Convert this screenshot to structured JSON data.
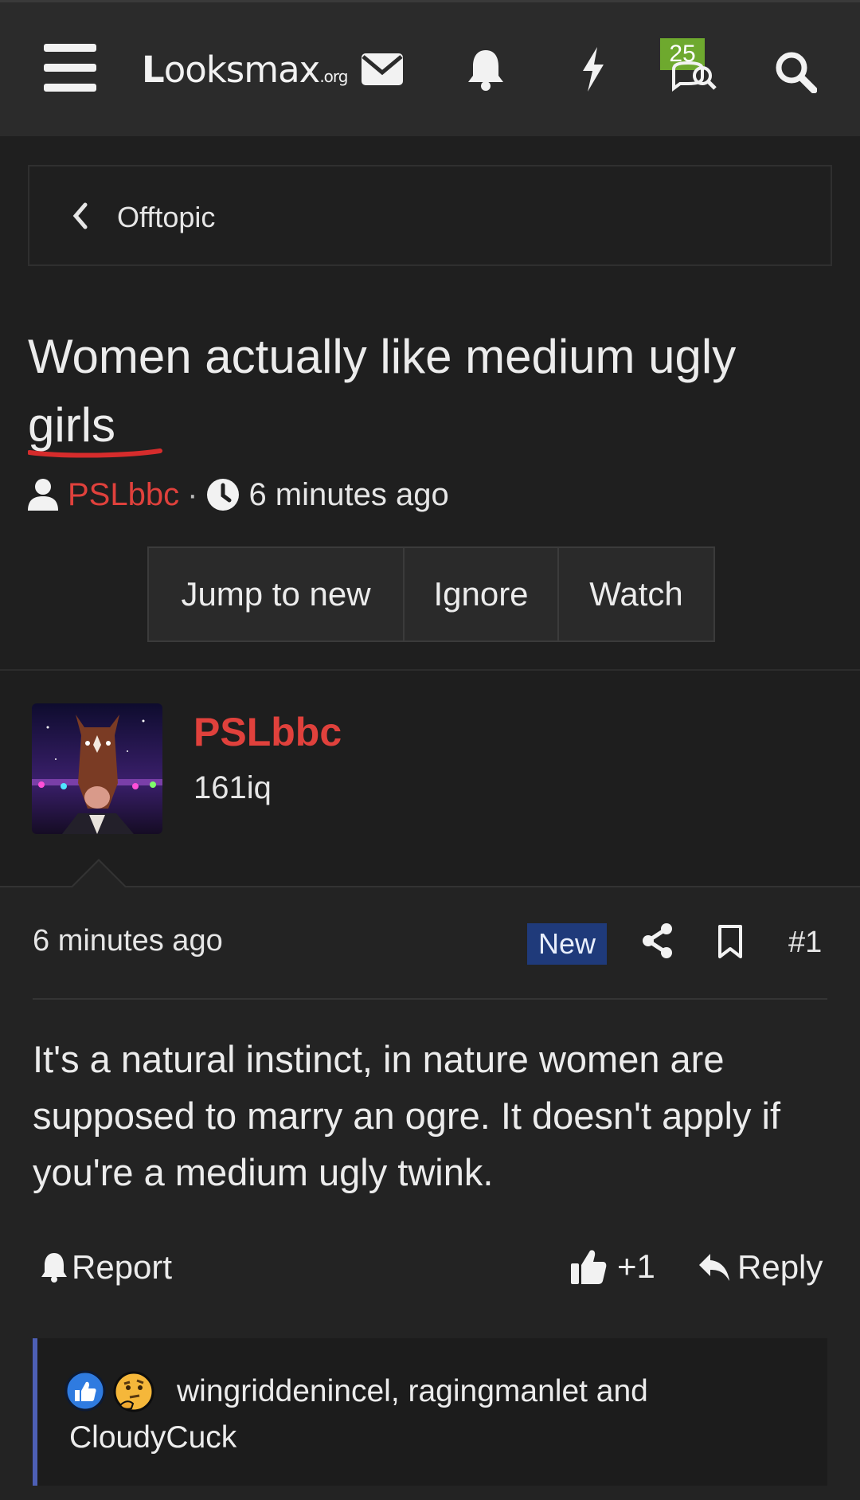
{
  "nav": {
    "logo_bold": "L",
    "logo_light": "ooks",
    "logo_max": "max",
    "logo_org": ".org",
    "badge_count": "25"
  },
  "breadcrumb": {
    "label": "Offtopic"
  },
  "thread": {
    "title": "Women actually like medium ugly girls",
    "author": "PSLbbc",
    "separator": "·",
    "time": "6 minutes ago"
  },
  "actions": {
    "jump_to_new": "Jump to new",
    "ignore": "Ignore",
    "watch": "Watch"
  },
  "user": {
    "name": "PSLbbc",
    "title": "161iq"
  },
  "post": {
    "time": "6 minutes ago",
    "new_badge": "New",
    "number": "#1",
    "body": "It's a natural instinct, in nature women are supposed to marry an ogre. It doesn't apply if you're a medium ugly twink.",
    "report_label": "Report",
    "like_label": "+1",
    "reply_label": "Reply",
    "reactions_text": "wingriddenincel, ragingmanlet and CloudyCuck"
  },
  "colors": {
    "accent_red": "#e0413c",
    "badge_green": "#6ea92e",
    "new_badge_blue": "#1f3a7a",
    "quote_border": "#4d5fb5"
  },
  "icons": [
    "menu-icon",
    "envelope-icon",
    "bell-icon",
    "bolt-icon",
    "chat-search-icon",
    "search-icon",
    "chevron-left-icon",
    "user-icon",
    "clock-icon",
    "share-icon",
    "bookmark-icon",
    "bell-report-icon",
    "thumbs-up-icon",
    "reply-icon",
    "like-reaction-icon",
    "thinking-reaction-icon"
  ]
}
